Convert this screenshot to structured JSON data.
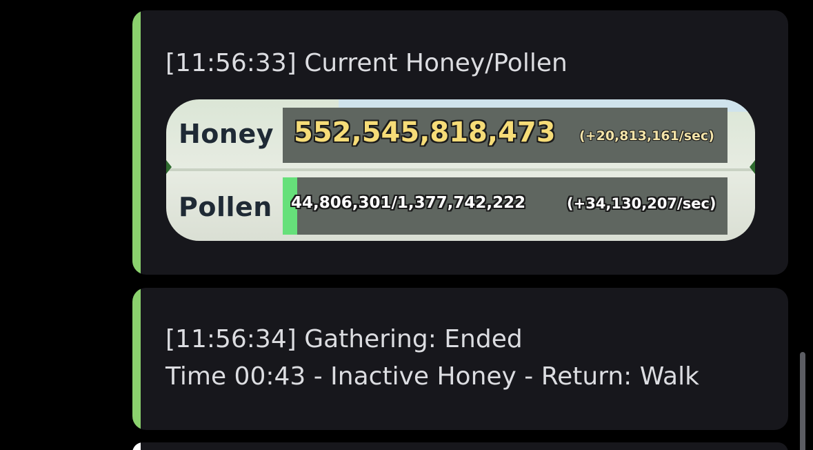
{
  "colors": {
    "background": "#000000",
    "embed_background": "#17171c",
    "accent_green": "#8bd16e",
    "text": "#dcdde1",
    "honey_amount": "#f6dc78",
    "pollen_fill": "#66e07a"
  },
  "messages": [
    {
      "line1": "[11:56:33] Current Honey/Pollen",
      "game_panel": {
        "honey_label": "Honey",
        "honey_amount": "552,545,818,473",
        "honey_rate": "(+20,813,161/sec)",
        "pollen_label": "Pollen",
        "pollen_amount": "44,806,301/1,377,742,222",
        "pollen_rate": "(+34,130,207/sec)",
        "pollen_fill_fraction": 0.0325
      }
    },
    {
      "line1": "[11:56:34] Gathering: Ended",
      "line2": "Time 00:43 - Inactive Honey - Return: Walk"
    }
  ]
}
